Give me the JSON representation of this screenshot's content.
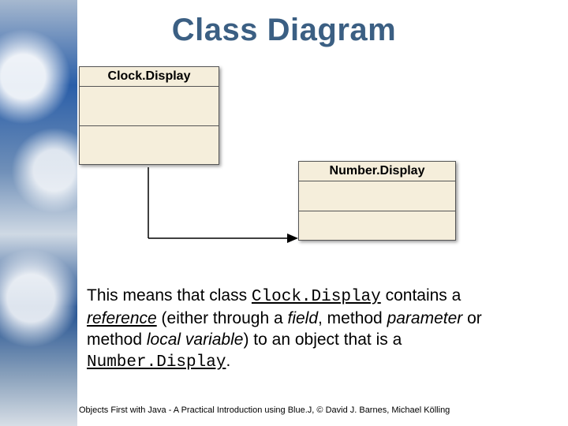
{
  "title": "Class Diagram",
  "uml": {
    "clock": {
      "name": "Clock.Display"
    },
    "number": {
      "name": "Number.Display"
    }
  },
  "explain": {
    "t1": "This means that class ",
    "c1": "Clock.Display",
    "t2": " contains a ",
    "ref": "reference",
    "t3": " (either through a ",
    "field": "field",
    "t4": ", method ",
    "param": "parameter",
    "t5": " or method ",
    "lvar": "local variable",
    "t6": ") to an object that is a ",
    "c2": "Number.Display",
    "t7": "."
  },
  "footer": "Objects First with Java - A Practical Introduction using Blue.J, © David J. Barnes, Michael Kölling"
}
